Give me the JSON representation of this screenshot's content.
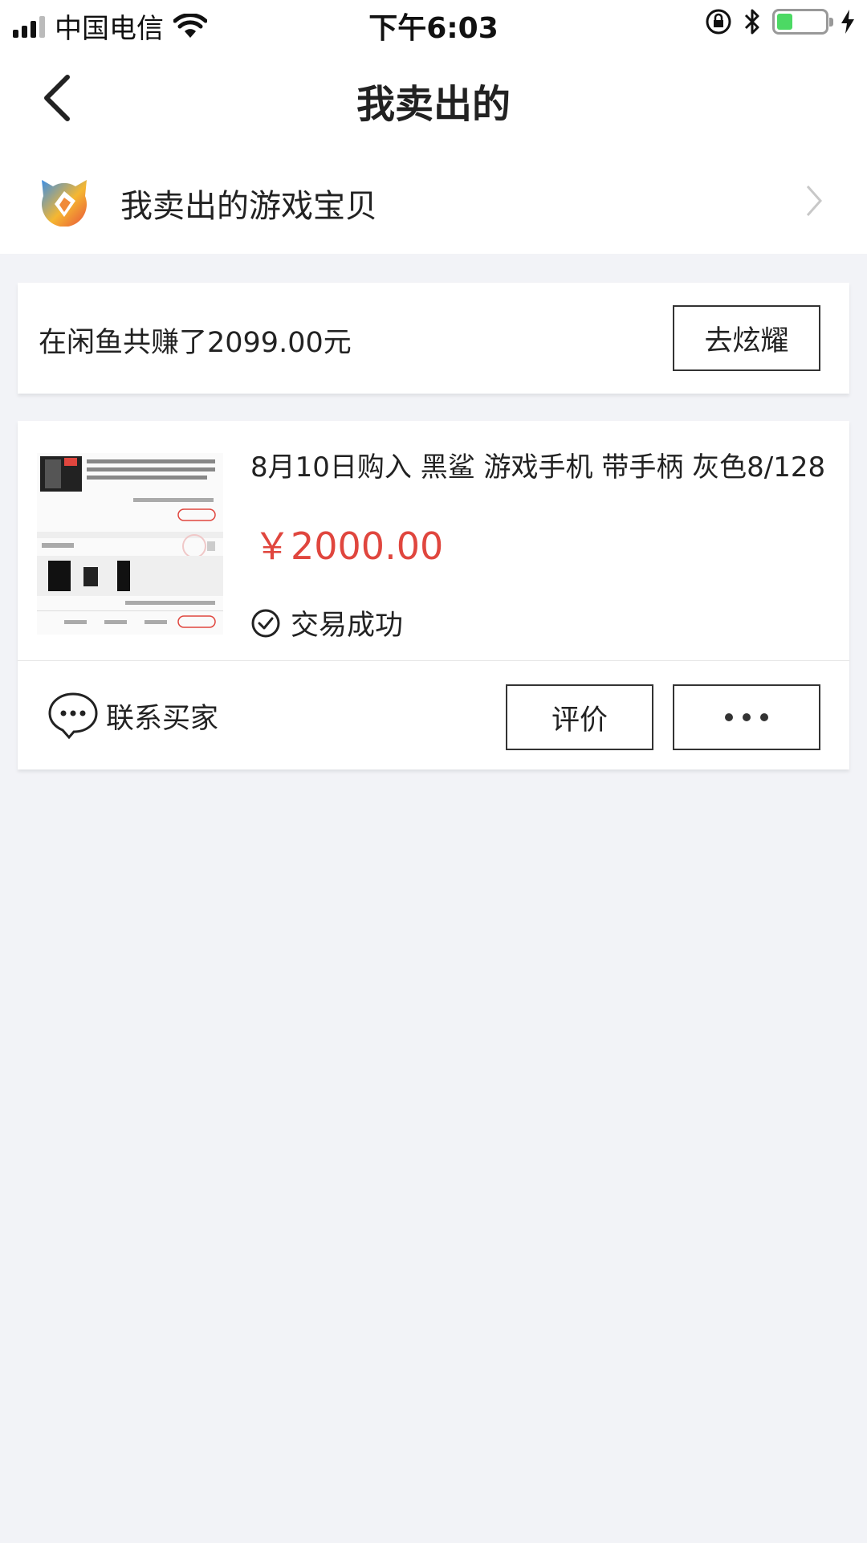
{
  "status_bar": {
    "carrier": "中国电信",
    "time": "下午6:03",
    "battery_level": 0.32
  },
  "nav": {
    "title": "我卖出的"
  },
  "game_section": {
    "label": "我卖出的游戏宝贝"
  },
  "earnings": {
    "text": "在闲鱼共赚了2099.00元",
    "button_label": "去炫耀"
  },
  "order": {
    "title": "8月10日购入 黑鲨 游戏手机 带手柄  灰色8/128",
    "price": "￥2000.00",
    "status": "交易成功",
    "contact_label": "联系买家",
    "review_label": "评价",
    "more_label": "more"
  },
  "colors": {
    "price": "#e0463e",
    "background": "#f2f3f7",
    "battery": "#4cd964"
  }
}
